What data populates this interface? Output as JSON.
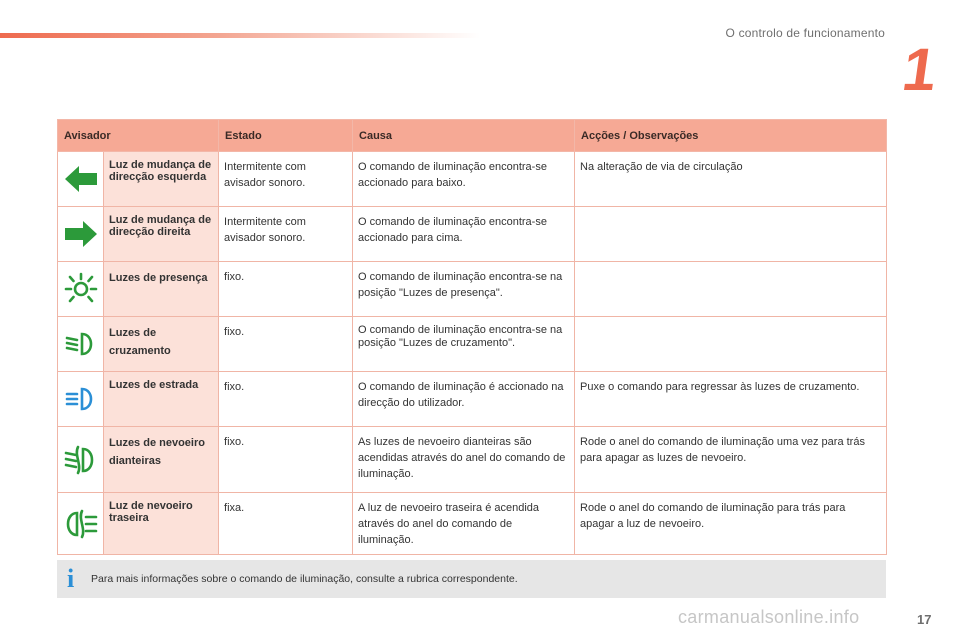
{
  "header": {
    "section_title": "O controlo de funcionamento",
    "chapter_number": "1"
  },
  "table": {
    "columns": [
      "Avisador",
      "Estado",
      "Causa",
      "Acções / Observações"
    ],
    "rows": [
      {
        "icon": "arrow-left-green-icon",
        "name": "Luz de mudança de direcção esquerda",
        "estado": "Intermitente com avisador sonoro.",
        "causa": "O comando de iluminação encontra-se accionado para baixo.",
        "accoes": "Na alteração de via de circulação"
      },
      {
        "icon": "arrow-right-green-icon",
        "name": "Luz de mudança de direcção direita",
        "estado": "Intermitente com avisador sonoro.",
        "causa": "O comando de iluminação encontra-se accionado para cima.",
        "accoes": ""
      },
      {
        "icon": "sidelights-icon",
        "name": "Luzes de presença",
        "estado": "fixo.",
        "causa": "O comando de iluminação encontra-se na posição \"Luzes de presença\".",
        "accoes": ""
      },
      {
        "icon": "dipped-beam-icon",
        "name": "Luzes de cruzamento",
        "estado": "fixo.",
        "causa": "O comando de iluminação encontra-se na posição \"Luzes de cruzamento\".",
        "accoes": ""
      },
      {
        "icon": "main-beam-icon",
        "name": "Luzes de estrada",
        "estado": "fixo.",
        "causa": "O comando de iluminação é accionado na direcção do utilizador.",
        "accoes": "Puxe o comando para regressar às luzes de cruzamento."
      },
      {
        "icon": "front-fog-icon",
        "name": "Luzes de nevoeiro dianteiras",
        "estado": "fixo.",
        "causa": "As luzes de nevoeiro dianteiras são acendidas através do anel do comando de iluminação.",
        "accoes": "Rode o anel do comando de iluminação uma vez para trás para apagar as luzes de nevoeiro."
      },
      {
        "icon": "rear-fog-icon",
        "name": "Luz de nevoeiro traseira",
        "estado": "fixa.",
        "causa": "A luz de nevoeiro traseira é acendida através do anel do comando de iluminação.",
        "accoes": "Rode o anel do comando de iluminação para trás para apagar a luz de nevoeiro."
      }
    ]
  },
  "info": {
    "icon": "info-icon",
    "text": "Para mais informações sobre o comando de iluminação, consulte a rubrica correspondente."
  },
  "footer": {
    "page_number": "17",
    "watermark": "carmanualsonline.info"
  },
  "colors": {
    "accent": "#ee6a4e",
    "header_bg": "#f6a995",
    "name_bg": "#fce1d9",
    "indicator_green": "#2c9a3a",
    "indicator_blue": "#2b8fd6",
    "info_bg": "#e6e6e6"
  }
}
